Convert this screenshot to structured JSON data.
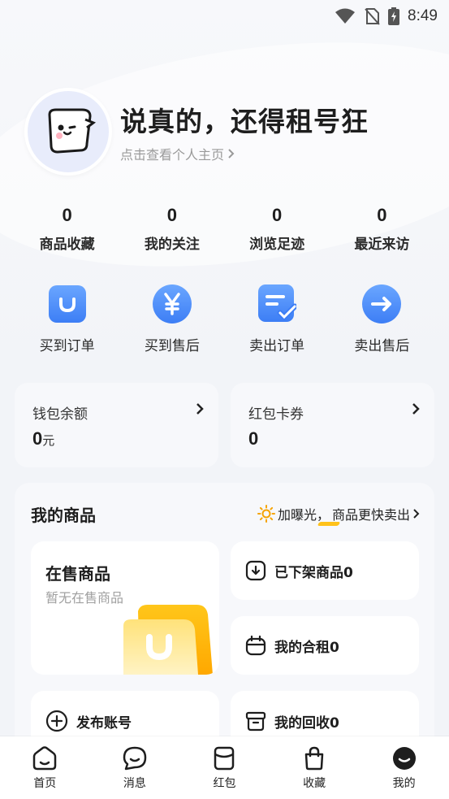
{
  "status_bar": {
    "time": "8:49",
    "icons": [
      "wifi-icon",
      "no-sim-icon",
      "battery-charging-icon"
    ]
  },
  "profile": {
    "username": "说真的，还得租号狂",
    "link_text": "点击查看个人主页",
    "avatar_icon": "ghost-mascot-icon"
  },
  "stats": [
    {
      "value": "0",
      "label": "商品收藏"
    },
    {
      "value": "0",
      "label": "我的关注"
    },
    {
      "value": "0",
      "label": "浏览足迹"
    },
    {
      "value": "0",
      "label": "最近来访"
    }
  ],
  "orders": [
    {
      "label": "买到订单",
      "icon": "bag-smile-icon"
    },
    {
      "label": "买到售后",
      "icon": "yen-icon"
    },
    {
      "label": "卖出订单",
      "icon": "note-check-icon"
    },
    {
      "label": "卖出售后",
      "icon": "arrow-right-icon"
    }
  ],
  "wallet": {
    "balance": {
      "title": "钱包余额",
      "value": "0",
      "unit": "元"
    },
    "coupons": {
      "title": "红包卡券",
      "value": "0"
    }
  },
  "products": {
    "title": "我的商品",
    "promo_highlight": "加曝光，",
    "promo_rest": "商品更快卖出",
    "on_sale": {
      "title": "在售商品",
      "subtitle": "暂无在售商品"
    },
    "delisted": "已下架商品0",
    "co_rent": "我的合租0",
    "recycle": "我的回收0",
    "publish": "发布账号"
  },
  "tabs": [
    {
      "label": "首页",
      "icon": "home-icon"
    },
    {
      "label": "消息",
      "icon": "message-icon"
    },
    {
      "label": "红包",
      "icon": "red-packet-icon"
    },
    {
      "label": "收藏",
      "icon": "bag-icon"
    },
    {
      "label": "我的",
      "icon": "me-icon"
    }
  ],
  "colors": {
    "accent_blue": "#4a8cf6",
    "promo_yellow": "#ffc21a",
    "text_dark": "#1e1e1e",
    "text_muted": "#9a9a9a"
  }
}
